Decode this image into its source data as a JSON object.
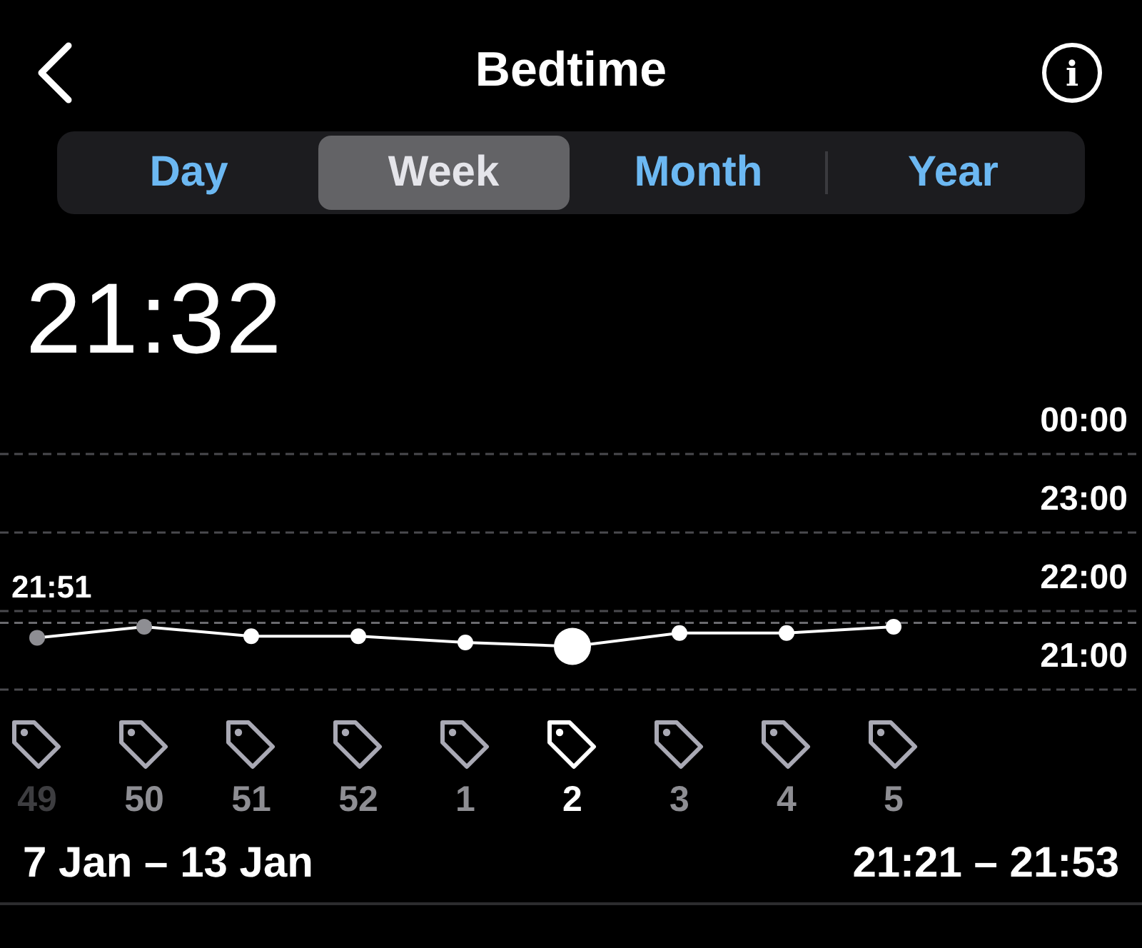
{
  "header": {
    "title": "Bedtime",
    "info": "i"
  },
  "tabs": [
    {
      "label": "Day",
      "selected": false
    },
    {
      "label": "Week",
      "selected": true
    },
    {
      "label": "Month",
      "selected": false
    },
    {
      "label": "Year",
      "selected": false
    }
  ],
  "average": "21:32",
  "chart": {
    "chart_data": {
      "type": "line",
      "categories": [
        "49",
        "50",
        "51",
        "52",
        "1",
        "2",
        "3",
        "4",
        "5"
      ],
      "series": [
        {
          "color": "#ffffff",
          "marker": "circle",
          "values": [
            21.66,
            21.8,
            21.68,
            21.68,
            21.6,
            21.55,
            21.72,
            21.72,
            21.8
          ]
        }
      ],
      "ylim": [
        21,
        24
      ],
      "yticks": [
        {
          "value": 24,
          "label": "00:00"
        },
        {
          "value": 23,
          "label": "23:00"
        },
        {
          "value": 22,
          "label": "22:00"
        },
        {
          "value": 21,
          "label": "21:00"
        }
      ],
      "ref_lines": [
        {
          "axis": "y",
          "value": 21.85
        }
      ]
    },
    "line_label": "21:51",
    "weeks": [
      {
        "selected": false,
        "faded": true
      },
      {
        "selected": false,
        "faded": true
      },
      {
        "selected": false,
        "faded": false
      },
      {
        "selected": false,
        "faded": false
      },
      {
        "selected": false,
        "faded": false
      },
      {
        "selected": true,
        "faded": false
      },
      {
        "selected": false,
        "faded": false
      },
      {
        "selected": false,
        "faded": false
      },
      {
        "selected": false,
        "faded": false
      }
    ]
  },
  "footer": {
    "range": "7 Jan – 13 Jan",
    "times": "21:21 – 21:53"
  }
}
